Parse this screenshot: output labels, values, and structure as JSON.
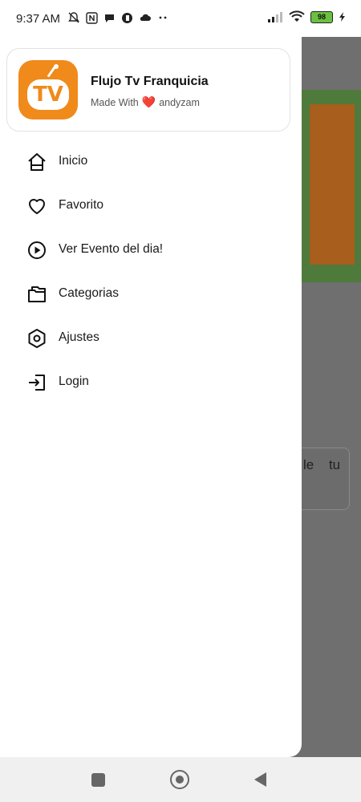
{
  "status_bar": {
    "time": "9:37 AM",
    "battery": "98",
    "icons": [
      "mute-icon",
      "nfc-icon",
      "chat-icon",
      "app-icon",
      "cloud-icon",
      "more-icon",
      "signal-icon",
      "wifi-icon",
      "battery-icon",
      "charging-icon"
    ]
  },
  "drawer": {
    "header": {
      "app_name": "Flujo Tv Franquicia",
      "made_with_prefix": "Made With",
      "made_with_heart": "❤️",
      "made_with_author": "andyzam",
      "logo_text": "TV"
    },
    "menu": [
      {
        "label": "Inicio",
        "icon": "home-icon"
      },
      {
        "label": "Favorito",
        "icon": "heart-icon"
      },
      {
        "label": "Ver Evento del dia!",
        "icon": "play-circle-icon"
      },
      {
        "label": "Categorias",
        "icon": "categories-icon"
      },
      {
        "label": "Ajustes",
        "icon": "settings-icon"
      },
      {
        "label": "Login",
        "icon": "login-icon"
      }
    ]
  },
  "background": {
    "card_text": "le tu"
  },
  "colors": {
    "accent": "#f08a1a",
    "scrim": "#6f6f6f",
    "heart": "#e0252c"
  }
}
